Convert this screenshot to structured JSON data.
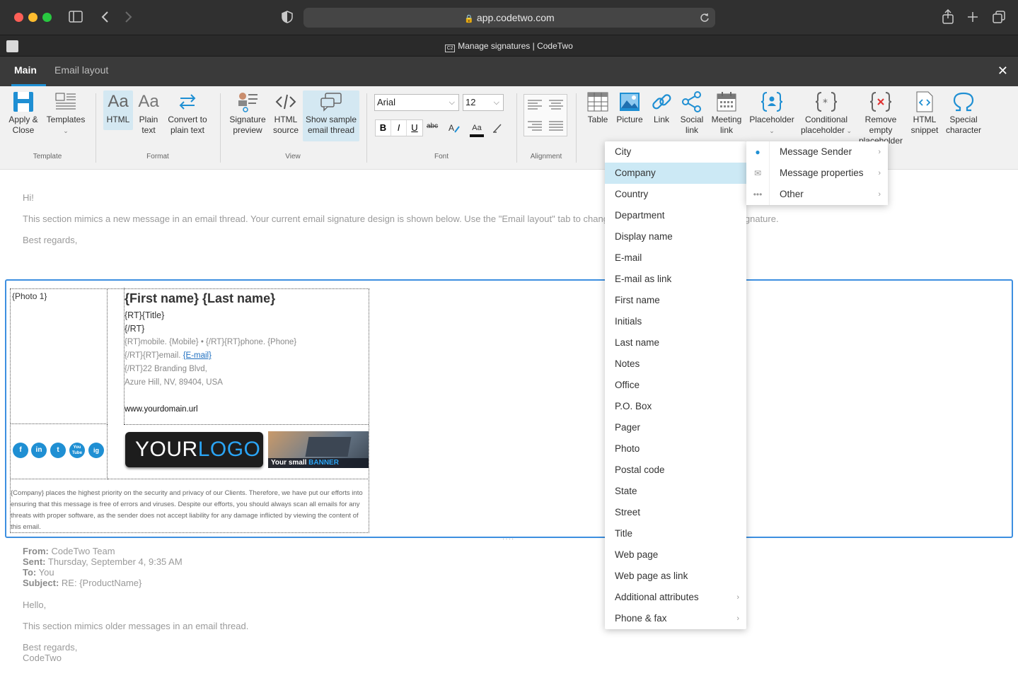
{
  "browser": {
    "url": "app.codetwo.com",
    "tab_title": "Manage signatures | CodeTwo"
  },
  "nav": {
    "tabs": [
      "Main",
      "Email layout"
    ],
    "close_glyph": "✕"
  },
  "ribbon": {
    "template": {
      "apply_close": [
        "Apply &",
        "Close"
      ],
      "templates": "Templates",
      "group": "Template"
    },
    "format": {
      "html": "HTML",
      "plain": [
        "Plain",
        "text"
      ],
      "convert": [
        "Convert to",
        "plain text"
      ],
      "group": "Format",
      "aa": "Aa"
    },
    "view": {
      "sig_preview": [
        "Signature",
        "preview"
      ],
      "html_source": [
        "HTML",
        "source"
      ],
      "show_sample": [
        "Show sample",
        "email thread"
      ],
      "group": "View"
    },
    "font": {
      "family": "Arial",
      "size": "12",
      "group": "Font",
      "bold": "B",
      "italic": "I",
      "underline": "U",
      "strike": "abc",
      "aa": "Aa"
    },
    "alignment": {
      "group": "Alignment"
    },
    "insert": {
      "table": "Table",
      "picture": "Picture",
      "link": "Link",
      "social": [
        "Social",
        "link"
      ],
      "meeting": [
        "Meeting",
        "link"
      ],
      "placeholder": "Placeholder",
      "conditional": [
        "Conditional",
        "placeholder"
      ],
      "remove": [
        "Remove",
        "empty",
        "placeholder"
      ],
      "snippet": [
        "HTML",
        "snippet"
      ],
      "special": [
        "Special",
        "character"
      ]
    }
  },
  "email_top": {
    "greeting": "Hi!",
    "line": "This section mimics a new message in an email thread. Your current email signature design is shown below. Use the \"Email layout\" tab to change the position and order of your signature.",
    "regards": "Best regards,"
  },
  "signature": {
    "photo": "{Photo 1}",
    "name": "{First name} {Last name}",
    "title": "{RT}{Title}",
    "rt_close": "{/RT}",
    "phones": "{RT}mobile. {Mobile} • {/RT}{RT}phone. {Phone}",
    "email_prefix": "{/RT}{RT}email. ",
    "email_link": "{E-mail}",
    "address1": "{/RT}22 Branding Blvd,",
    "address2": "Azure Hill, NV, 89404, USA",
    "website": "www.yourdomain.url",
    "logo_a": "YOUR",
    "logo_b": "LOGO",
    "banner_a": "Your small ",
    "banner_b": "BANNER",
    "social_icons": [
      "f",
      "in",
      "t",
      "You Tube",
      "ig"
    ],
    "disclaimer": "{Company} places the highest priority on the security and privacy of our Clients. Therefore, we have put our efforts into ensuring that this message is free of errors and viruses. Despite our efforts, you should always scan all emails for any threats with proper software, as the sender does not accept liability for any damage inflicted by viewing the content of this email."
  },
  "email_bottom": {
    "from_label": "From:",
    "from": " CodeTwo Team",
    "sent_label": "Sent:",
    "sent": " Thursday, September 4, 9:35 AM",
    "to_label": "To:",
    "to": " You",
    "subject_label": "Subject:",
    "subject": " RE: {ProductName}",
    "hello": "Hello,",
    "line": "This section mimics older messages in an email thread.",
    "regards": "Best regards,",
    "sign": "CodeTwo"
  },
  "menu": {
    "items": [
      "City",
      "Company",
      "Country",
      "Department",
      "Display name",
      "E-mail",
      "E-mail as link",
      "First name",
      "Initials",
      "Last name",
      "Notes",
      "Office",
      "P.O. Box",
      "Pager",
      "Photo",
      "Postal code",
      "State",
      "Street",
      "Title",
      "Web page",
      "Web page as link",
      "Additional attributes",
      "Phone & fax"
    ],
    "highlighted": "Company"
  },
  "submenu": {
    "items": [
      "Message Sender",
      "Message properties",
      "Other"
    ]
  },
  "colors": {
    "accent": "#1f8fd3",
    "highlight": "#cce9f5",
    "nav_bg": "#3a3a3a"
  }
}
